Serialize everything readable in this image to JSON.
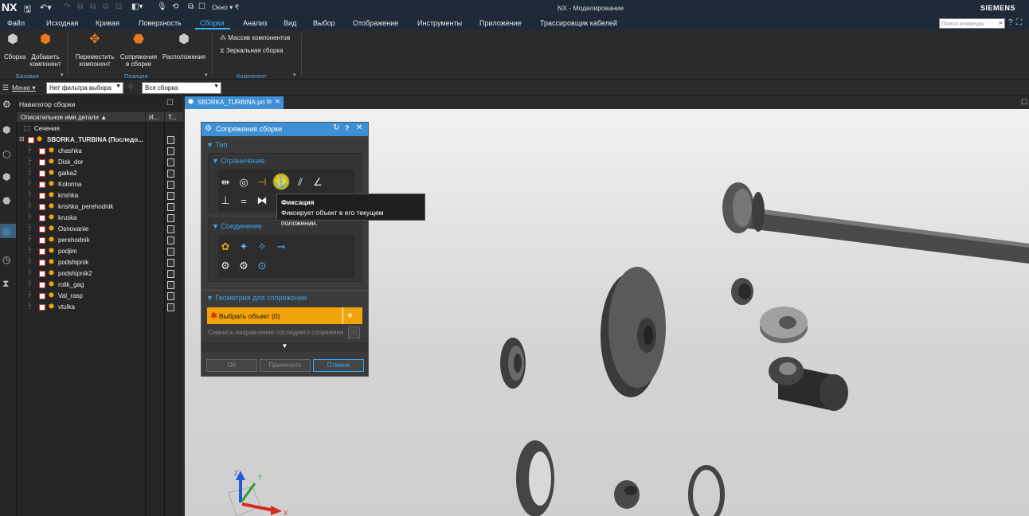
{
  "app": {
    "logo": "NX",
    "window_menu": "Окно",
    "title": "NX - Моделирование",
    "brand": "SIEMENS",
    "search_placeholder": "Поиск команды"
  },
  "menu": [
    "Файл",
    "Исходная",
    "Кривая",
    "Поверхность",
    "Сборки",
    "Анализ",
    "Вид",
    "Выбор",
    "Отображение",
    "Инструменты",
    "Приложение",
    "Трассировщик кабелей"
  ],
  "ribbon": {
    "assembly": "Сборка",
    "add_component": [
      "Добавить",
      "компонент"
    ],
    "move_component": [
      "Переместить",
      "компонент"
    ],
    "constraints": [
      "Сопряжения",
      "в сборке"
    ],
    "arrangements": "Расположения",
    "pattern": "Массив компонентов",
    "mirror": "Зеркальная сборка",
    "group_base": "Базовая",
    "group_position": "Позиция",
    "group_component": "Компонент"
  },
  "filterbar": {
    "menu": "Меню",
    "filter": "Нет фильтра выбора",
    "scope": "Вся сборка"
  },
  "tab": {
    "label": "SBORKA_TURBINA.prt"
  },
  "navigator": {
    "title": "Навигатор сборки",
    "col_name": "Описательное имя детали",
    "col_i": "И...",
    "col_t": "Т...",
    "sections": "Сечения",
    "root": "SBORKA_TURBINA (Последо...",
    "items": [
      "chashka",
      "Disk_dor",
      "gaika2",
      "Kolonna",
      "krishka",
      "krishka_perehodnik",
      "kruska",
      "Osnovanie",
      "perehodnik",
      "podjim",
      "podshipnik",
      "podshipnik2",
      "rolik_gag",
      "Val_rasp",
      "vtulka"
    ]
  },
  "dialog": {
    "title": "Сопряжения сборки",
    "sec_type": "Тип",
    "sec_constraint": "Ограничение",
    "sec_connection": "Соединение",
    "sec_geometry": "Геометрия для сопряжения",
    "select_object": "Выбрать объект (0)",
    "reverse": "Сменить направление последнего сопряжени",
    "ok": "ОК",
    "apply": "Применить",
    "cancel": "Отмена"
  },
  "tooltip": {
    "title": "Фиксация",
    "text": "Фиксирует объект в его текущем положении."
  },
  "triad": {
    "x": "X",
    "y": "Y",
    "z": "Z"
  },
  "colors": {
    "accent": "#3db6ff",
    "highlight": "#f0a30a",
    "titlebar": "#1f2a38"
  }
}
